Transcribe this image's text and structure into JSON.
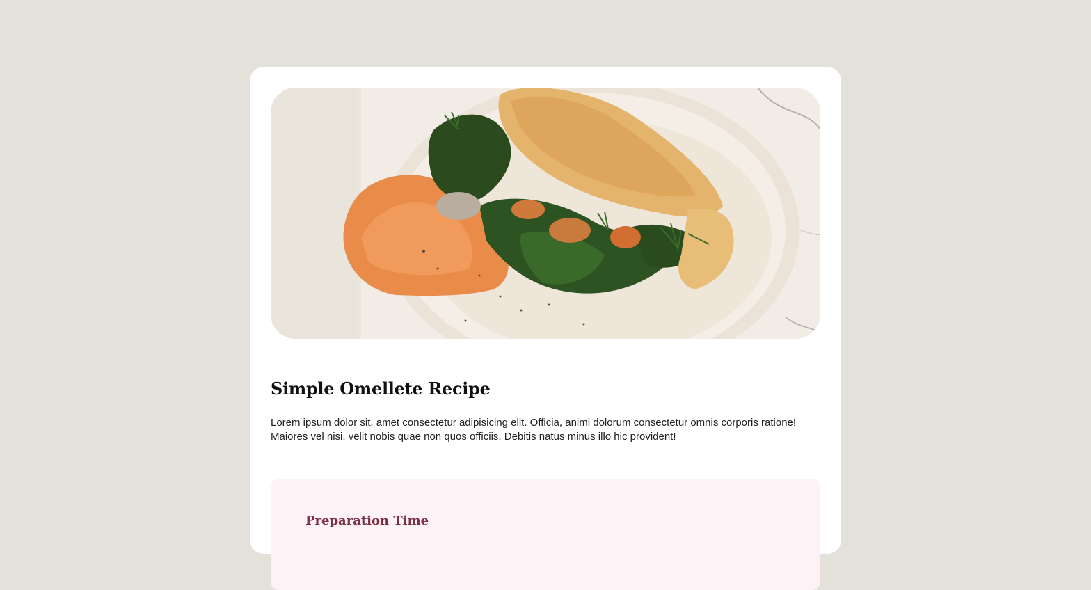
{
  "recipe": {
    "title": "Simple Omellete Recipe",
    "description": "Lorem ipsum dolor sit, amet consectetur adipisicing elit. Officia, animi dolorum consectetur omnis corporis ratione! Maiores vel nisi, velit nobis quae non quos officiis. Debitis natus minus illo hic provident!",
    "image_alt": "Omelette on a plate with spinach and orange dip"
  },
  "preparation": {
    "heading": "Preparation Time"
  },
  "colors": {
    "page_background": "#e4e0da",
    "card_background": "#ffffff",
    "prep_background": "#fdf3f6",
    "prep_heading": "#7a2f43"
  }
}
